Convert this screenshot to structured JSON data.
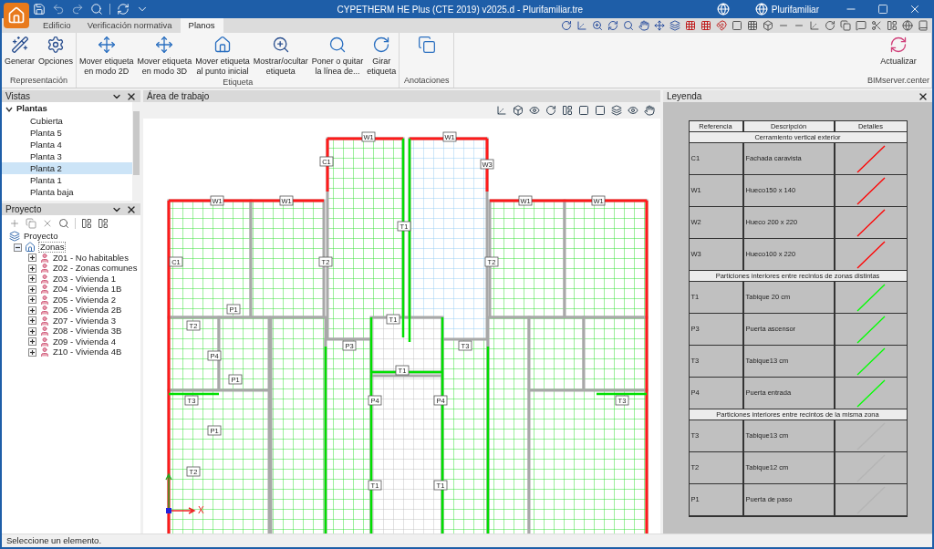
{
  "window": {
    "title": "CYPETHERM HE Plus (CTE 2019) v2025.d - Plurifamiliar.tre",
    "project": "Plurifamiliar"
  },
  "tabs": [
    {
      "label": "Edificio",
      "selected": false
    },
    {
      "label": "Verificación normativa",
      "selected": false
    },
    {
      "label": "Planos",
      "selected": true
    }
  ],
  "ribbon_groups": [
    {
      "label": "Representación",
      "buttons": [
        "Generar",
        "Opciones"
      ]
    },
    {
      "label": "Etiqueta",
      "buttons": [
        "Mover etiqueta\nen modo 2D",
        "Mover etiqueta\nen modo 3D",
        "Mover etiqueta\nal punto inicial",
        "Mostrar/ocultar\netiqueta",
        "Poner o quitar\nla línea de...",
        "Girar\netiqueta"
      ]
    },
    {
      "label": "Anotaciones"
    },
    {
      "label": "BIMserver.center",
      "buttons": [
        "Actualizar"
      ]
    }
  ],
  "vistas": {
    "title": "Vistas",
    "root": {
      "label": "Plantas",
      "expanded": true,
      "children": [
        {
          "label": "Cubierta",
          "selected": false
        },
        {
          "label": "Planta 5",
          "selected": false
        },
        {
          "label": "Planta 4",
          "selected": false
        },
        {
          "label": "Planta 3",
          "selected": false
        },
        {
          "label": "Planta 2",
          "selected": true
        },
        {
          "label": "Planta 1",
          "selected": false
        },
        {
          "label": "Planta baja",
          "selected": false
        }
      ]
    }
  },
  "proyecto": {
    "title": "Proyecto",
    "root": {
      "label": "Proyecto",
      "children": [
        {
          "label": "Zonas",
          "expanded": true,
          "selected": true,
          "children": [
            {
              "label": "Z01 - No habitables",
              "expanded": false
            },
            {
              "label": "Z02 - Zonas comunes",
              "expanded": false
            },
            {
              "label": "Z03 - Vivienda 1",
              "expanded": false
            },
            {
              "label": "Z04 - Vivienda 1B",
              "expanded": false
            },
            {
              "label": "Z05 - Vivienda 2",
              "expanded": false
            },
            {
              "label": "Z06 - Vivienda 2B",
              "expanded": false
            },
            {
              "label": "Z07 - Vivienda 3",
              "expanded": false
            },
            {
              "label": "Z08 - Vivienda 3B",
              "expanded": false
            },
            {
              "label": "Z09 - Vivienda 4",
              "expanded": false
            },
            {
              "label": "Z10 - Vivienda 4B",
              "expanded": false
            }
          ]
        }
      ]
    }
  },
  "workspace": {
    "title": "Área de trabajo",
    "plan_labels": [
      "W1",
      "W1",
      "C1",
      "W3",
      "W1",
      "W1",
      "W1",
      "W1",
      "T1",
      "C1",
      "T2",
      "T2",
      "P1",
      "T1",
      "T2",
      "P3",
      "T3",
      "P4",
      "T1",
      "P1",
      "T3",
      "P4",
      "P4",
      "T3",
      "P1",
      "T2",
      "T1",
      "T1"
    ],
    "axis_label": "X"
  },
  "legend": {
    "title": "Leyenda",
    "columns": [
      "Referencia",
      "Descripción",
      "Detalles"
    ],
    "sections": [
      {
        "title": "Cerramiento vertical exterior",
        "rows": [
          {
            "ref": "C1",
            "description": "Fachada caravista",
            "color": "#ff0000"
          },
          {
            "ref": "W1",
            "description": "Hueco150 x 140",
            "color": "#ff0000"
          },
          {
            "ref": "W2",
            "description": "Hueco 200 x 220",
            "color": "#ff0000"
          },
          {
            "ref": "W3",
            "description": "Hueco100 x 220",
            "color": "#ff0000"
          }
        ]
      },
      {
        "title": "Particiones interiores entre recintos de zonas distintas",
        "rows": [
          {
            "ref": "T1",
            "description": "Tabique 20 cm",
            "color": "#00ff00"
          },
          {
            "ref": "P3",
            "description": "Puerta ascensor",
            "color": "#00ff00"
          },
          {
            "ref": "T3",
            "description": "Tabique13 cm",
            "color": "#00ff00"
          },
          {
            "ref": "P4",
            "description": "Puerta entrada",
            "color": "#00ff00"
          }
        ]
      },
      {
        "title": "Particiones interiores entre recintos de la misma zona",
        "rows": [
          {
            "ref": "T3",
            "description": "Tabique13 cm",
            "color": "#b4b4b4"
          },
          {
            "ref": "T2",
            "description": "Tabique12 cm",
            "color": "#b4b4b4"
          },
          {
            "ref": "P1",
            "description": "Puerta de paso",
            "color": "#b4b4b4"
          }
        ]
      }
    ]
  },
  "status_bar": "Seleccione un elemento."
}
